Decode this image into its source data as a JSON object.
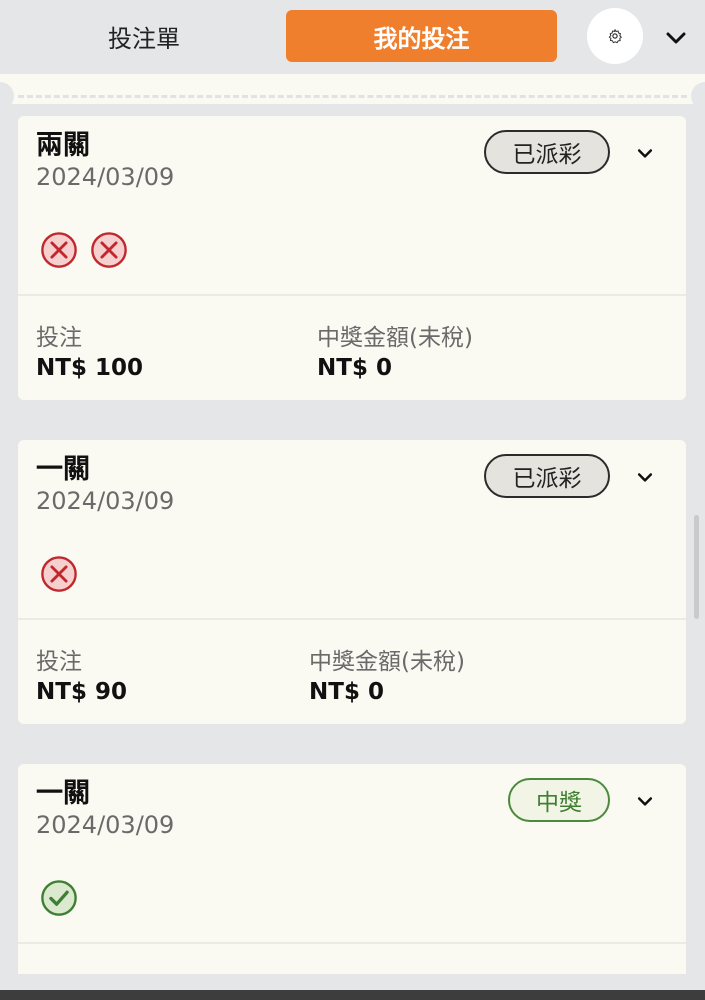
{
  "header": {
    "tab_betslip": "投注單",
    "tab_mybets": "我的投注",
    "settings_icon": "gear-icon",
    "collapse_icon": "chevron-down-icon"
  },
  "colors": {
    "accent_orange": "#ef7f2d",
    "card_bg": "#fbfaf2",
    "page_bg": "#e5e6e8",
    "lost_red": "#c0282d",
    "won_green": "#3e7f32"
  },
  "bets": [
    {
      "title": "兩關",
      "date": "2024/03/09",
      "status": "已派彩",
      "results": [
        "lost-icon",
        "lost-icon"
      ],
      "stake_label": "投注",
      "stake_value": "NT$ 100",
      "payout_label": "中獎金額(未稅)",
      "payout_value": "NT$ 0"
    },
    {
      "title": "一關",
      "date": "2024/03/09",
      "status": "已派彩",
      "results": [
        "lost-icon"
      ],
      "stake_label": "投注",
      "stake_value": "NT$ 90",
      "payout_label": "中獎金額(未稅)",
      "payout_value": "NT$ 0"
    },
    {
      "title": "一關",
      "date": "2024/03/09",
      "status": "中獎",
      "results": [
        "won-icon"
      ]
    }
  ]
}
